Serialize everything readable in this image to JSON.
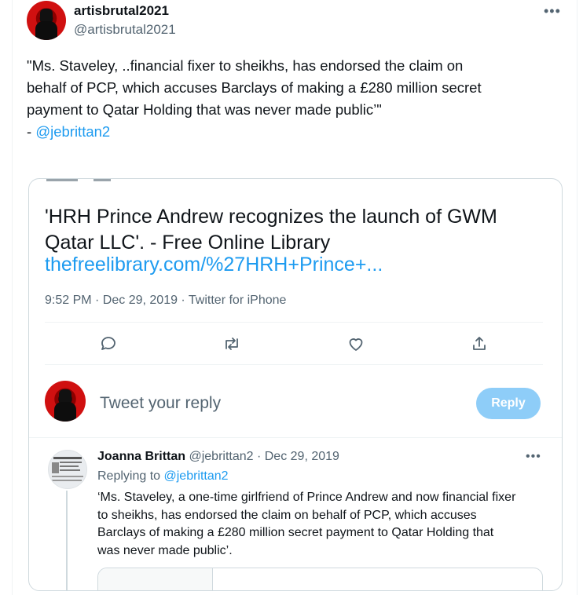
{
  "author": {
    "name": "artisbrutal2021",
    "handle": "@artisbrutal2021"
  },
  "tweet": {
    "lines": [
      "\"Ms. Staveley, ..financial fixer to sheikhs, has endorsed the claim on",
      "behalf of PCP, which accuses Barclays of making a £280 million secret",
      "payment to Qatar Holding that was never made public’\""
    ],
    "attribution_prefix": "- ",
    "attribution_link": "@jebrittan2"
  },
  "embed": {
    "title_lines": [
      "'HRH Prince Andrew recognizes the launch of GWM",
      "Qatar LLC'. - Free Online Library"
    ],
    "link": "thefreelibrary.com/%27HRH+Prince+...",
    "meta": "9:52 PM · Dec 29, 2019 · Twitter for iPhone",
    "actions": [
      "reply-icon",
      "retweet-icon",
      "like-icon",
      "share-icon"
    ],
    "reply_placeholder": "Tweet your reply",
    "reply_button": "Reply",
    "reply_button_color": "#8ecdf8"
  },
  "reply_tweet": {
    "name": "Joanna Brittan",
    "handle_date": "@jebrittan2 · Dec 29, 2019",
    "replying_prefix": "Replying to ",
    "replying_to": "@jebrittan2",
    "lines": [
      "‘Ms. Staveley, a one-time girlfriend of Prince Andrew and now financial fixer",
      "to sheikhs, has endorsed the claim on behalf of PCP, which accuses",
      "Barclays of making a £280 million secret payment to Qatar Holding that",
      "was never made public’."
    ]
  },
  "colors": {
    "link": "#1d9bf0",
    "muted": "#536471",
    "text": "#0f1419"
  }
}
